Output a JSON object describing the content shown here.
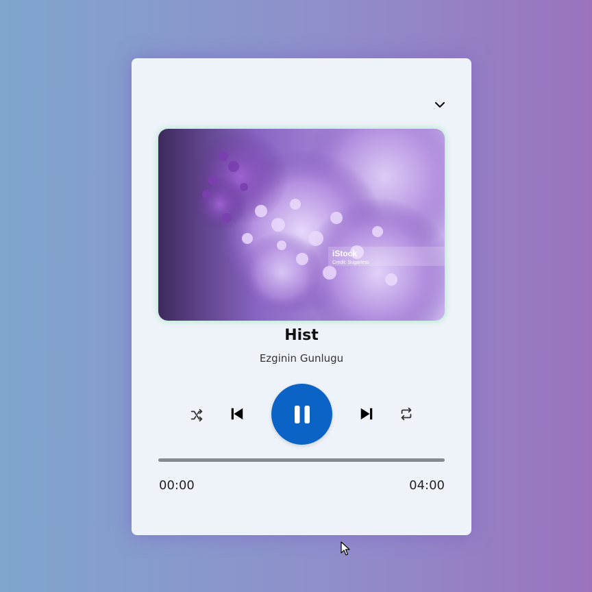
{
  "player": {
    "title": "Hist",
    "artist": "Ezginin Gunlugu",
    "current_time": "00:00",
    "total_time": "04:00",
    "progress_fraction": 0.0,
    "state": "playing",
    "accent_color": "#0b63c5"
  },
  "artwork": {
    "watermark": "iStock",
    "credit": "Credit: Sugarless"
  },
  "icons": {
    "collapse": "chevron-down-icon",
    "shuffle": "shuffle-icon",
    "previous": "skip-previous-icon",
    "pause": "pause-icon",
    "next": "skip-next-icon",
    "repeat": "repeat-icon"
  }
}
